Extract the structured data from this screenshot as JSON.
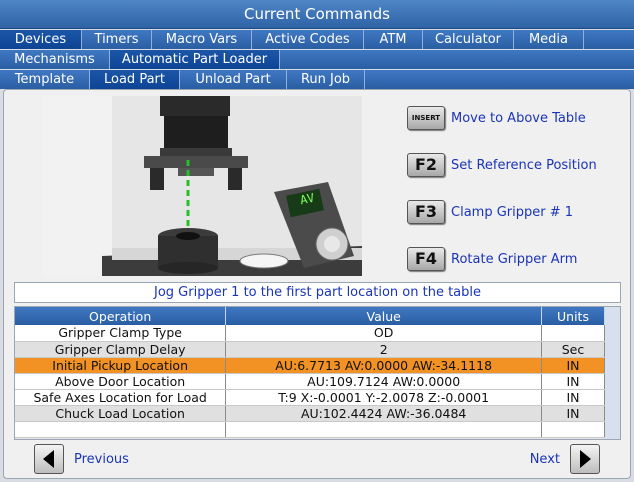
{
  "window_title": "Current Commands",
  "tabs_row1": [
    "Devices",
    "Timers",
    "Macro Vars",
    "Active Codes",
    "ATM",
    "Calculator",
    "Media"
  ],
  "tabs_row2": [
    "Mechanisms",
    "Automatic Part Loader"
  ],
  "tabs_row3": [
    "Template",
    "Load Part",
    "Unload Part",
    "Run Job"
  ],
  "pendant_label": "AV",
  "commands": [
    {
      "key": "INSERT",
      "label": "Move to Above Table"
    },
    {
      "key": "F2",
      "label": "Set Reference Position"
    },
    {
      "key": "F3",
      "label": "Clamp Gripper # 1"
    },
    {
      "key": "F4",
      "label": "Rotate Gripper Arm"
    }
  ],
  "instruction": "Jog Gripper 1 to the first part location on the table",
  "table": {
    "headers": [
      "Operation",
      "Value",
      "Units"
    ],
    "rows": [
      [
        "Gripper Clamp Type",
        "OD",
        ""
      ],
      [
        "Gripper Clamp Delay",
        "2",
        "Sec"
      ],
      [
        "Initial Pickup Location",
        "AU:6.7713 AV:0.0000 AW:-34.1118",
        "IN"
      ],
      [
        "Above Door Location",
        "AU:109.7124 AW:0.0000",
        "IN"
      ],
      [
        "Safe Axes Location for Load",
        "T:9 X:-0.0001 Y:-2.0078 Z:-0.0001",
        "IN"
      ],
      [
        "Chuck Load Location",
        "AU:102.4424 AW:-36.0484",
        "IN"
      ],
      [
        "",
        "",
        ""
      ]
    ],
    "selected_row": 2
  },
  "nav": {
    "previous": "Previous",
    "next": "Next"
  }
}
